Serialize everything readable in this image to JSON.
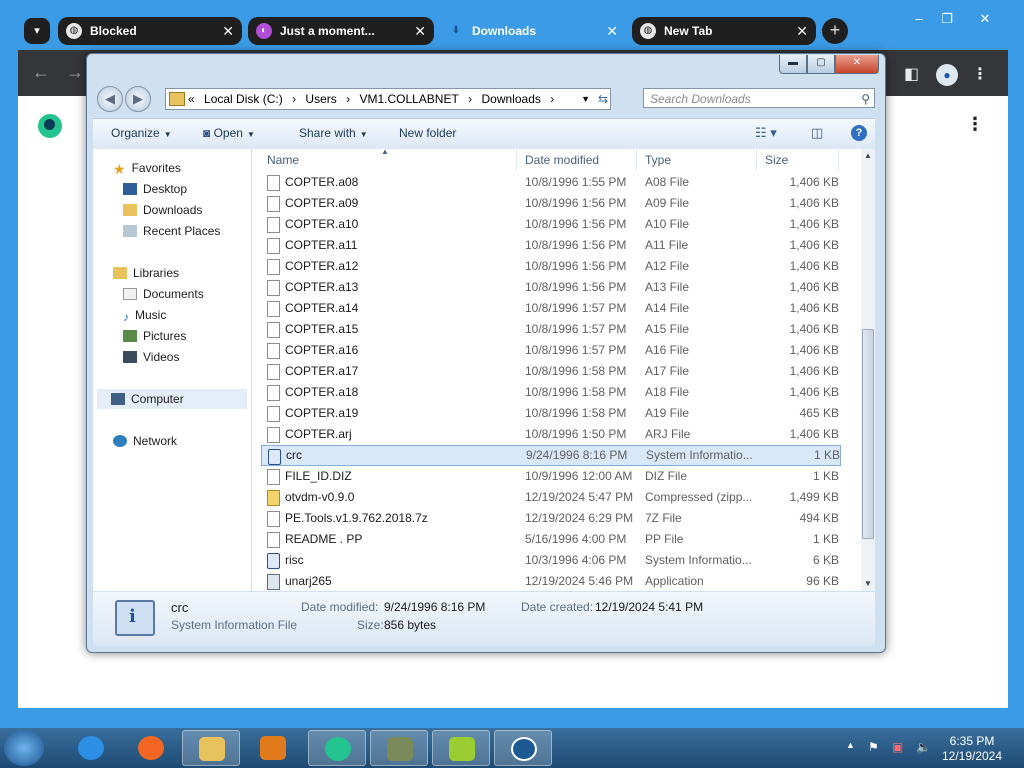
{
  "browser": {
    "tabs": [
      {
        "label": "Blocked"
      },
      {
        "label": "Just a moment..."
      },
      {
        "label": "Downloads"
      },
      {
        "label": "New Tab"
      }
    ],
    "close_glyph": "✕",
    "new_tab_glyph": "+",
    "back_glyph": "←",
    "forward_glyph": "→",
    "menu_glyph": "⋮",
    "window_min": "–",
    "window_max": "❐",
    "window_close": "✕"
  },
  "explorer": {
    "address": {
      "prefix": "«",
      "crumbs": [
        "Local Disk (C:)",
        "›",
        "Users",
        "›",
        "VM1.COLLABNET",
        "›",
        "Downloads",
        "›"
      ]
    },
    "search_placeholder": "Search Downloads",
    "toolbar": {
      "organize": "Organize",
      "open": "Open",
      "share_with": "Share with",
      "new_folder": "New folder"
    },
    "nav": {
      "favorites": "Favorites",
      "desktop": "Desktop",
      "downloads": "Downloads",
      "recent_places": "Recent Places",
      "libraries": "Libraries",
      "documents": "Documents",
      "music": "Music",
      "pictures": "Pictures",
      "videos": "Videos",
      "computer": "Computer",
      "network": "Network"
    },
    "columns": {
      "name": "Name",
      "date": "Date modified",
      "type": "Type",
      "size": "Size"
    },
    "files": [
      {
        "name": "COPTER.a08",
        "date": "10/8/1996 1:55 PM",
        "type": "A08 File",
        "size": "1,406 KB",
        "icon": "file"
      },
      {
        "name": "COPTER.a09",
        "date": "10/8/1996 1:56 PM",
        "type": "A09 File",
        "size": "1,406 KB",
        "icon": "file"
      },
      {
        "name": "COPTER.a10",
        "date": "10/8/1996 1:56 PM",
        "type": "A10 File",
        "size": "1,406 KB",
        "icon": "file"
      },
      {
        "name": "COPTER.a11",
        "date": "10/8/1996 1:56 PM",
        "type": "A11 File",
        "size": "1,406 KB",
        "icon": "file"
      },
      {
        "name": "COPTER.a12",
        "date": "10/8/1996 1:56 PM",
        "type": "A12 File",
        "size": "1,406 KB",
        "icon": "file"
      },
      {
        "name": "COPTER.a13",
        "date": "10/8/1996 1:56 PM",
        "type": "A13 File",
        "size": "1,406 KB",
        "icon": "file"
      },
      {
        "name": "COPTER.a14",
        "date": "10/8/1996 1:57 PM",
        "type": "A14 File",
        "size": "1,406 KB",
        "icon": "file"
      },
      {
        "name": "COPTER.a15",
        "date": "10/8/1996 1:57 PM",
        "type": "A15 File",
        "size": "1,406 KB",
        "icon": "file"
      },
      {
        "name": "COPTER.a16",
        "date": "10/8/1996 1:57 PM",
        "type": "A16 File",
        "size": "1,406 KB",
        "icon": "file"
      },
      {
        "name": "COPTER.a17",
        "date": "10/8/1996 1:58 PM",
        "type": "A17 File",
        "size": "1,406 KB",
        "icon": "file"
      },
      {
        "name": "COPTER.a18",
        "date": "10/8/1996 1:58 PM",
        "type": "A18 File",
        "size": "1,406 KB",
        "icon": "file"
      },
      {
        "name": "COPTER.a19",
        "date": "10/8/1996 1:58 PM",
        "type": "A19 File",
        "size": "465 KB",
        "icon": "file"
      },
      {
        "name": "COPTER.arj",
        "date": "10/8/1996 1:50 PM",
        "type": "ARJ File",
        "size": "1,406 KB",
        "icon": "file"
      },
      {
        "name": "crc",
        "date": "9/24/1996 8:16 PM",
        "type": "System Informatio...",
        "size": "1 KB",
        "icon": "info",
        "selected": true
      },
      {
        "name": "FILE_ID.DIZ",
        "date": "10/9/1996 12:00 AM",
        "type": "DIZ File",
        "size": "1 KB",
        "icon": "file"
      },
      {
        "name": "otvdm-v0.9.0",
        "date": "12/19/2024 5:47 PM",
        "type": "Compressed (zipp...",
        "size": "1,499 KB",
        "icon": "zip"
      },
      {
        "name": "PE.Tools.v1.9.762.2018.7z",
        "date": "12/19/2024 6:29 PM",
        "type": "7Z File",
        "size": "494 KB",
        "icon": "file"
      },
      {
        "name": "README  . PP",
        "date": "5/16/1996 4:00 PM",
        "type": "PP File",
        "size": "1 KB",
        "icon": "file"
      },
      {
        "name": "risc",
        "date": "10/3/1996 4:06 PM",
        "type": "System Informatio...",
        "size": "6 KB",
        "icon": "info"
      },
      {
        "name": "unarj265",
        "date": "12/19/2024 5:46 PM",
        "type": "Application",
        "size": "96 KB",
        "icon": "app"
      }
    ],
    "details": {
      "name": "crc",
      "kind": "System Information File",
      "date_modified_label": "Date modified:",
      "date_modified": "9/24/1996 8:16 PM",
      "date_created_label": "Date created:",
      "date_created": "12/19/2024 5:41 PM",
      "size_label": "Size:",
      "size": "856 bytes"
    }
  },
  "taskbar": {
    "time": "6:35 PM",
    "date": "12/19/2024"
  }
}
